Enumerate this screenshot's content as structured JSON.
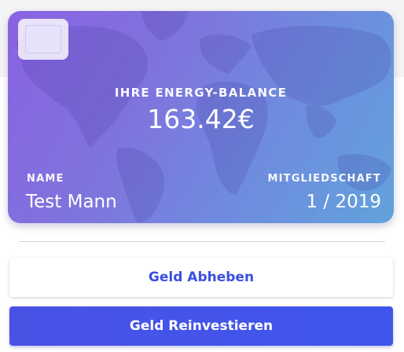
{
  "card": {
    "balance_label": "IHRE ENERGY-BALANCE",
    "balance_value": "163.42€",
    "name_label": "NAME",
    "name_value": "Test Mann",
    "membership_label": "MITGLIEDSCHAFT",
    "membership_value": "1 / 2019"
  },
  "actions": {
    "withdraw_label": "Geld Abheben",
    "reinvest_label": "Geld Reinvestieren"
  },
  "colors": {
    "accent": "#3b4fe0",
    "card_gradient_start": "#8a62e2",
    "card_gradient_end": "#62a2dc"
  },
  "icons": {
    "card_chip": "card-chip-icon"
  }
}
